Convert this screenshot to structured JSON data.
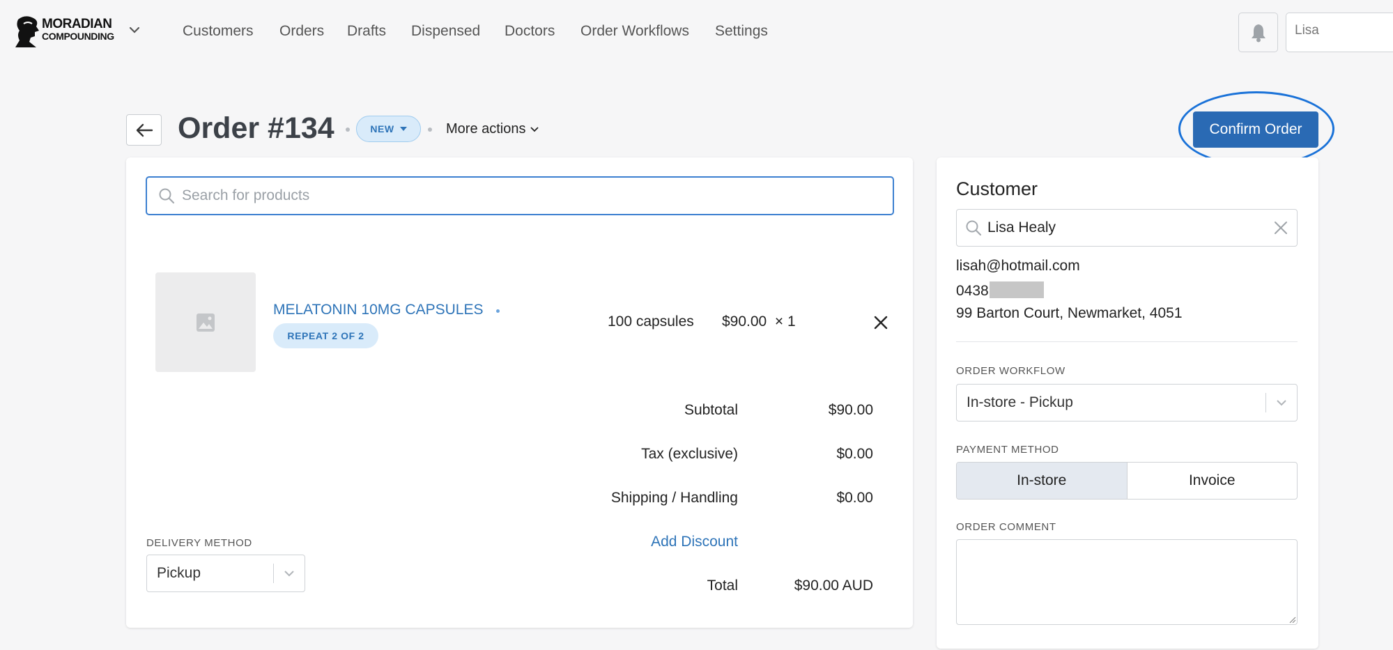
{
  "brand": {
    "line1": "MORADIAN",
    "line2": "COMPOUNDING"
  },
  "nav": {
    "items": [
      "Customers",
      "Orders",
      "Drafts",
      "Dispensed",
      "Doctors",
      "Order Workflows",
      "Settings"
    ]
  },
  "user": {
    "name": "Lisa"
  },
  "order": {
    "title": "Order #134",
    "status": "NEW",
    "more_actions": "More actions",
    "confirm_label": "Confirm Order"
  },
  "products": {
    "search_placeholder": "Search for products",
    "items": [
      {
        "name": "MELATONIN 10MG CAPSULES",
        "badge": "REPEAT 2 OF 2",
        "quantity_desc": "100 capsules",
        "price": "$90.00",
        "multiplier": "× 1"
      }
    ]
  },
  "summary": {
    "subtotal_label": "Subtotal",
    "subtotal": "$90.00",
    "tax_label": "Tax (exclusive)",
    "tax": "$0.00",
    "shipping_label": "Shipping / Handling",
    "shipping": "$0.00",
    "discount_link": "Add Discount",
    "total_label": "Total",
    "total": "$90.00 AUD"
  },
  "delivery": {
    "label": "DELIVERY METHOD",
    "value": "Pickup"
  },
  "customer": {
    "heading": "Customer",
    "name": "Lisa Healy",
    "email": "lisah@hotmail.com",
    "phone_prefix": "0438",
    "address": "99 Barton Court, Newmarket, 4051"
  },
  "workflow": {
    "label": "ORDER WORKFLOW",
    "value": "In-store - Pickup"
  },
  "payment": {
    "label": "PAYMENT METHOD",
    "options": [
      "In-store",
      "Invoice"
    ],
    "selected": "In-store"
  },
  "comment": {
    "label": "ORDER COMMENT",
    "value": ""
  },
  "colors": {
    "accent": "#2a6ab4",
    "link": "#2e74b8",
    "badge_bg": "#d9ebfa",
    "highlight": "#1a72d8"
  },
  "icons": [
    "logo-icon",
    "chevron-down-icon",
    "bell-icon",
    "arrow-left-icon",
    "caret-down-icon",
    "search-icon",
    "image-placeholder-icon",
    "close-icon"
  ]
}
